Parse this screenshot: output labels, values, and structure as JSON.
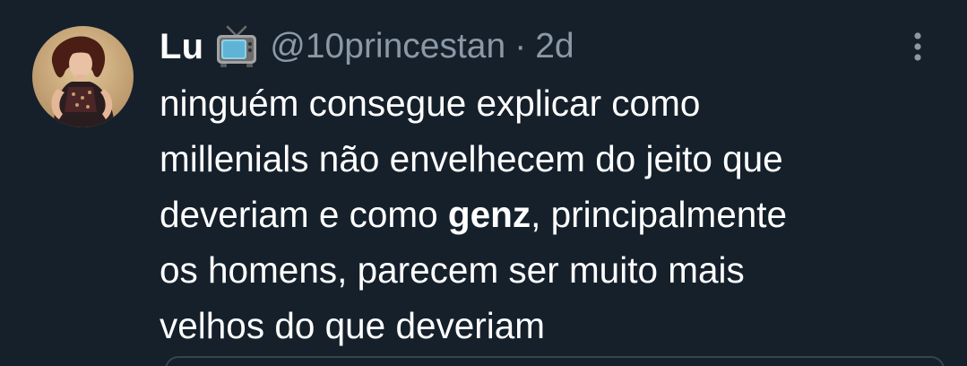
{
  "tweet": {
    "author": {
      "display_name": "Lu",
      "badge_icon": "tv-emoji-icon",
      "handle": "@10princestan",
      "separator": "·",
      "time": "2d"
    },
    "text_lines": [
      {
        "before": "ninguém consegue explicar como"
      },
      {
        "before": "millenials não envelhecem do jeito que"
      },
      {
        "before": "deveriam e como ",
        "bold": "genz",
        "after": ", principalmente"
      },
      {
        "before": "os homens, parecem ser muito mais"
      },
      {
        "before": "velhos do que deveriam"
      }
    ],
    "more_icon": "more-vertical-icon"
  },
  "colors": {
    "background": "#15202b",
    "primary_text": "#ffffff",
    "secondary_text": "#8b98a5",
    "border": "#38444d"
  }
}
